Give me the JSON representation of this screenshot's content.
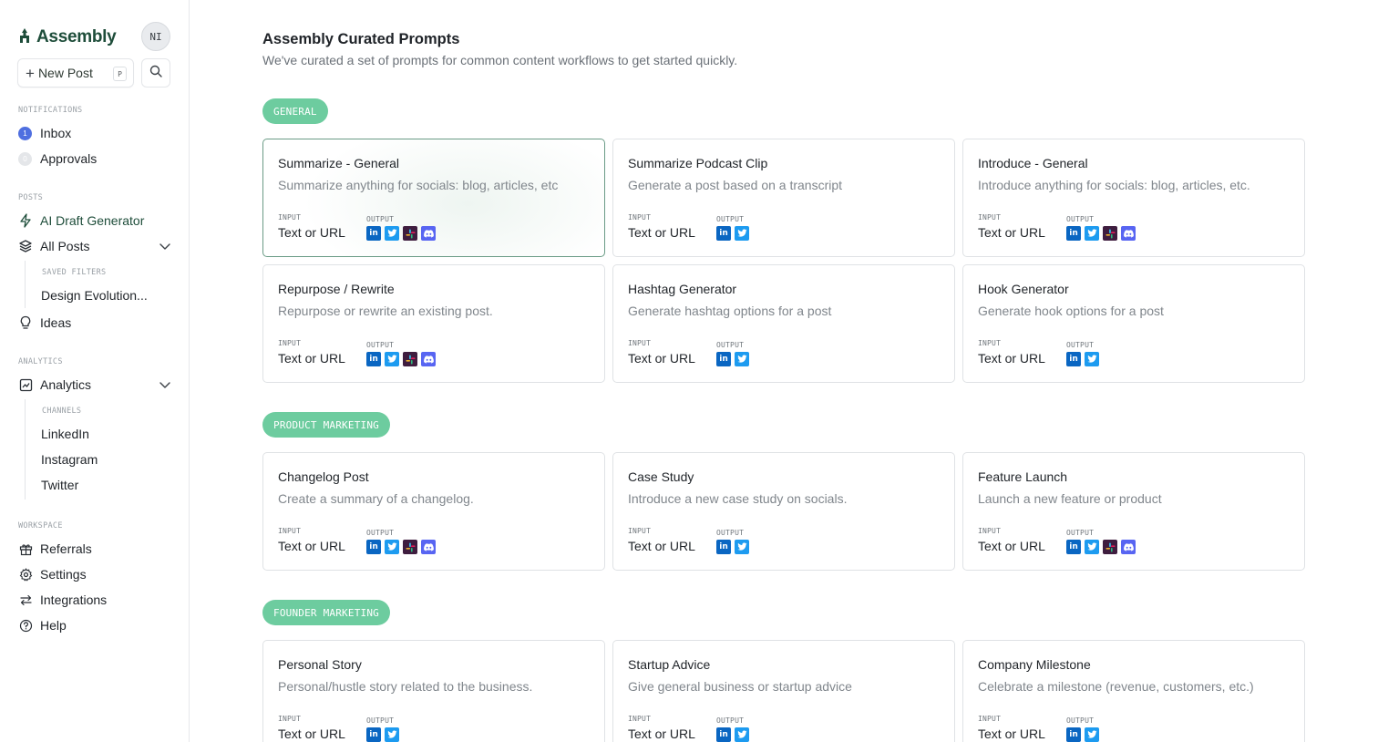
{
  "sidebar": {
    "brand": "Assembly",
    "avatar_initials": "NI",
    "new_post_label": "New Post",
    "new_post_shortcut": "P",
    "notifications_label": "NOTIFICATIONS",
    "inbox_label": "Inbox",
    "inbox_count": "1",
    "approvals_label": "Approvals",
    "approvals_count": "0",
    "posts_label": "POSTS",
    "ai_draft_label": "AI Draft Generator",
    "all_posts_label": "All Posts",
    "saved_filters_label": "SAVED FILTERS",
    "saved_filter_item": "Design Evolution...",
    "ideas_label": "Ideas",
    "analytics_section_label": "ANALYTICS",
    "analytics_label": "Analytics",
    "channels_label": "CHANNELS",
    "channels": [
      "LinkedIn",
      "Instagram",
      "Twitter"
    ],
    "workspace_label": "WORKSPACE",
    "referrals_label": "Referrals",
    "settings_label": "Settings",
    "integrations_label": "Integrations",
    "help_label": "Help"
  },
  "main": {
    "title": "Assembly Curated Prompts",
    "subtitle": "We've curated a set of prompts for common content workflows to get started quickly.",
    "input_label": "INPUT",
    "output_label": "OUTPUT",
    "input_value": "Text or URL",
    "categories": [
      {
        "name": "GENERAL",
        "cards": [
          {
            "title": "Summarize - General",
            "desc": "Summarize anything for socials: blog, articles, etc",
            "outputs": [
              "linkedin-icon",
              "twitter-icon",
              "slack-icon",
              "discord-icon"
            ]
          },
          {
            "title": "Summarize Podcast Clip",
            "desc": "Generate a post based on a transcript",
            "outputs": [
              "linkedin-icon",
              "twitter-icon"
            ]
          },
          {
            "title": "Introduce - General",
            "desc": "Introduce anything for socials: blog, articles, etc.",
            "outputs": [
              "linkedin-icon",
              "twitter-icon",
              "slack-icon",
              "discord-icon"
            ]
          },
          {
            "title": "Repurpose / Rewrite",
            "desc": "Repurpose or rewrite an existing post.",
            "outputs": [
              "linkedin-icon",
              "twitter-icon",
              "slack-icon",
              "discord-icon"
            ]
          },
          {
            "title": "Hashtag Generator",
            "desc": "Generate hashtag options for a post",
            "outputs": [
              "linkedin-icon",
              "twitter-icon"
            ]
          },
          {
            "title": "Hook Generator",
            "desc": "Generate hook options for a post",
            "outputs": [
              "linkedin-icon",
              "twitter-icon"
            ]
          }
        ]
      },
      {
        "name": "PRODUCT MARKETING",
        "cards": [
          {
            "title": "Changelog Post",
            "desc": "Create a summary of a changelog.",
            "outputs": [
              "linkedin-icon",
              "twitter-icon",
              "slack-icon",
              "discord-icon"
            ]
          },
          {
            "title": "Case Study",
            "desc": "Introduce a new case study on socials.",
            "outputs": [
              "linkedin-icon",
              "twitter-icon"
            ]
          },
          {
            "title": "Feature Launch",
            "desc": "Launch a new feature or product",
            "outputs": [
              "linkedin-icon",
              "twitter-icon",
              "slack-icon",
              "discord-icon"
            ]
          }
        ]
      },
      {
        "name": "FOUNDER MARKETING",
        "cards": [
          {
            "title": "Personal Story",
            "desc": "Personal/hustle story related to the business.",
            "outputs": [
              "linkedin-icon",
              "twitter-icon"
            ]
          },
          {
            "title": "Startup Advice",
            "desc": "Give general business or startup advice",
            "outputs": [
              "linkedin-icon",
              "twitter-icon"
            ]
          },
          {
            "title": "Company Milestone",
            "desc": "Celebrate a milestone (revenue, customers, etc.)",
            "outputs": [
              "linkedin-icon",
              "twitter-icon"
            ]
          }
        ]
      }
    ]
  },
  "colors": {
    "brand_green": "#1e4d3a",
    "pill_green": "#6dcc9f",
    "linkedin": "#0a66c2",
    "twitter": "#1d9bf0",
    "slack": "#3f1d3f",
    "discord": "#5865f2",
    "badge_blue": "#4f6fe0"
  }
}
